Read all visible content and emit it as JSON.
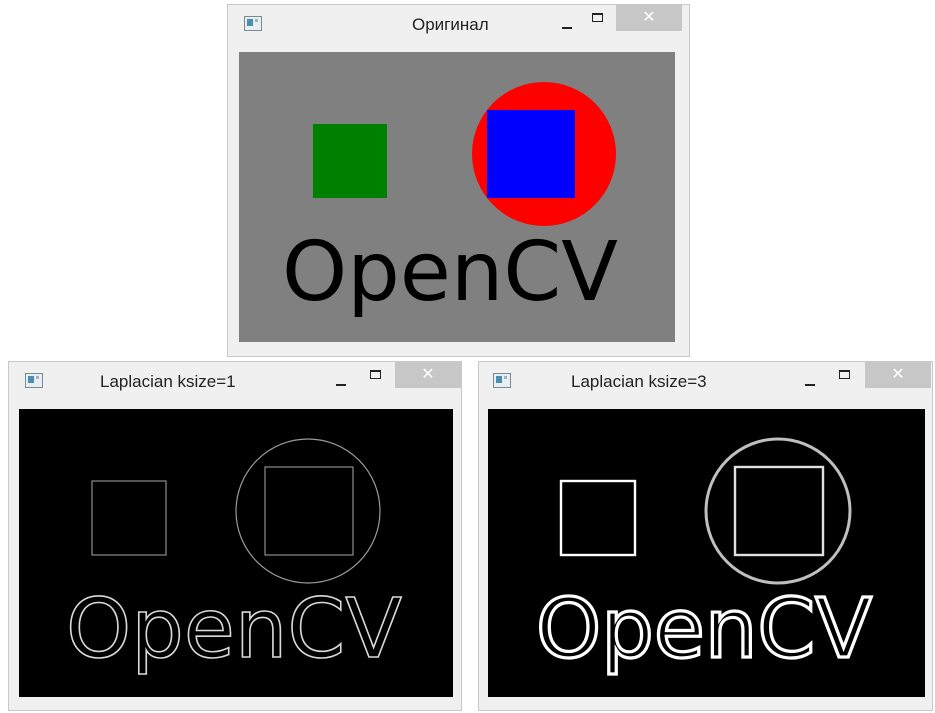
{
  "windows": {
    "original": {
      "title": "Оригинал",
      "close_glyph": "✕",
      "image_text": "OpenCV"
    },
    "laplacian1": {
      "title": "Laplacian ksize=1",
      "close_glyph": "✕",
      "image_text": "OpenCV"
    },
    "laplacian3": {
      "title": "Laplacian ksize=3",
      "close_glyph": "✕",
      "image_text": "OpenCV"
    }
  },
  "colors": {
    "original_background": "#808080",
    "green_square": "#008000",
    "red_circle": "#ff0000",
    "blue_square": "#0000ff",
    "text": "#000000",
    "laplacian_background": "#000000",
    "laplacian1_edge": "#9a9a9a",
    "laplacian3_edge": "#ffffff"
  },
  "icons": [
    "app-icon",
    "minimize-icon",
    "maximize-icon",
    "close-icon"
  ]
}
